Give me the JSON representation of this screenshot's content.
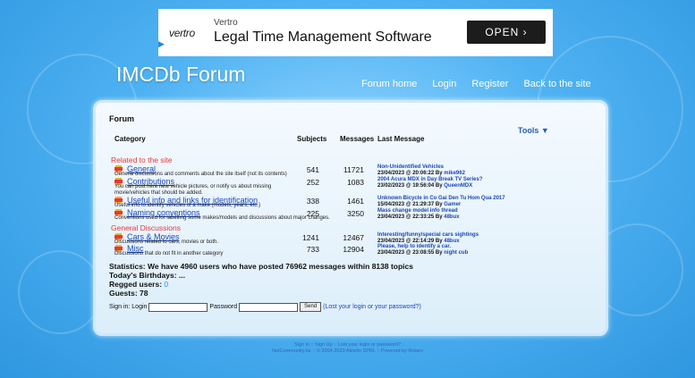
{
  "ad": {
    "logo": "vertro",
    "brand": "Vertro",
    "headline": "Legal Time Management Software",
    "cta": "OPEN"
  },
  "site_title": "IMCDb Forum",
  "nav": [
    "Forum home",
    "Login",
    "Register",
    "Back to the site"
  ],
  "panel_title": "Forum",
  "tools": "Tools",
  "headers": {
    "category": "Category",
    "subjects": "Subjects",
    "messages": "Messages",
    "last": "Last Message"
  },
  "sections": [
    "Related to the site",
    "General Discussions"
  ],
  "categories": [
    {
      "name": "General",
      "desc": "General discussions and comments about the site itself (not its contents)",
      "subjects": "541",
      "messages": "11721",
      "last_topic": "Non-Unidentified Vehicles",
      "last_date": "23/04/2023 @ 20:06:22 By",
      "last_user": "mike962"
    },
    {
      "name": "Contributions",
      "desc": "You can post here new vehicle pictures, or notify us about missing movie/vehicles that should be added.",
      "subjects": "252",
      "messages": "1083",
      "last_topic": "2004 Acura MDX in Day Break TV Series?",
      "last_date": "23/02/2023 @ 19:56:04 By",
      "last_user": "QueenMDX"
    },
    {
      "name": "Useful info and links for identification",
      "desc": "Useful info to identify vehicles of a make (models, years, etc.)",
      "subjects": "338",
      "messages": "1461",
      "last_topic": "Unknown Bicycle in Co Gai Den Tu Hom Qua 2017",
      "last_date": "15/04/2023 @ 21:29:37 By",
      "last_user": "Gamer"
    },
    {
      "name": "Naming conventions",
      "desc": "Conventions used for labelling some makes/models and discussions about major changes.",
      "subjects": "225",
      "messages": "3250",
      "last_topic": "Mass change model info thread",
      "last_date": "23/04/2023 @ 22:33:25 By",
      "last_user": "48bux"
    },
    {
      "name": "Cars & Movies",
      "desc": "Discussions related to cars, movies or both.",
      "subjects": "1241",
      "messages": "12467",
      "last_topic": "Interesting/funny/special cars sightings",
      "last_date": "23/04/2023 @ 22:14:29 By",
      "last_user": "48bux"
    },
    {
      "name": "Misc",
      "desc": "Discussions that do not fit in another category",
      "subjects": "733",
      "messages": "12904",
      "last_topic": "Please, help to identify a car.",
      "last_date": "23/04/2023 @ 23:08:55 By",
      "last_user": "night cub"
    }
  ],
  "stats": {
    "line1": "Statistics: We have 4960 users who have posted 76962 messages within 8138 topics",
    "birthdays": "Today's Birthdays: ...",
    "logged_label": "Regged users:",
    "logged_count": "0",
    "guests": "Guests: 78"
  },
  "signin": {
    "label": "Sign in: Login",
    "password": "Password",
    "send": "Send",
    "lost": "(Lost your login or your password?)"
  },
  "footer": {
    "line1": "Sign in :: Sign Up :: Lost your login or password?",
    "line2": "NetCommunity.be :: © 2004-2023 Akretin SPRL :: Powered by Rotaro"
  }
}
